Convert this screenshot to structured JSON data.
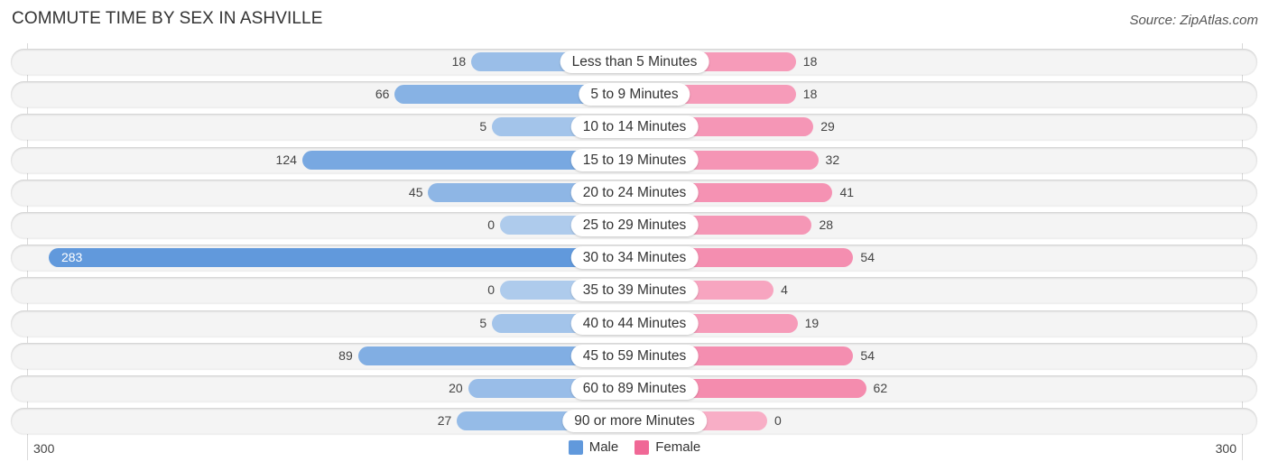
{
  "header": {
    "title": "COMMUTE TIME BY SEX IN ASHVILLE",
    "source": "Source: ZipAtlas.com"
  },
  "colors": {
    "male_strong": "#6199dc",
    "male_light": "#aecbec",
    "female_strong": "#f06896",
    "female_light": "#f8aec6"
  },
  "chart_data": {
    "type": "bar",
    "orientation": "horizontal-diverging",
    "title": "COMMUTE TIME BY SEX IN ASHVILLE",
    "categories": [
      "Less than 5 Minutes",
      "5 to 9 Minutes",
      "10 to 14 Minutes",
      "15 to 19 Minutes",
      "20 to 24 Minutes",
      "25 to 29 Minutes",
      "30 to 34 Minutes",
      "35 to 39 Minutes",
      "40 to 44 Minutes",
      "45 to 59 Minutes",
      "60 to 89 Minutes",
      "90 or more Minutes"
    ],
    "series": [
      {
        "name": "Male",
        "values": [
          18,
          66,
          5,
          124,
          45,
          0,
          283,
          0,
          5,
          89,
          20,
          27
        ]
      },
      {
        "name": "Female",
        "values": [
          18,
          18,
          29,
          32,
          41,
          28,
          54,
          4,
          19,
          54,
          62,
          0
        ]
      }
    ],
    "axis": {
      "left_label": "300",
      "right_label": "300",
      "range": [
        0,
        300
      ]
    },
    "legend": {
      "position": "bottom-center",
      "entries": [
        "Male",
        "Female"
      ]
    },
    "grid": false
  }
}
